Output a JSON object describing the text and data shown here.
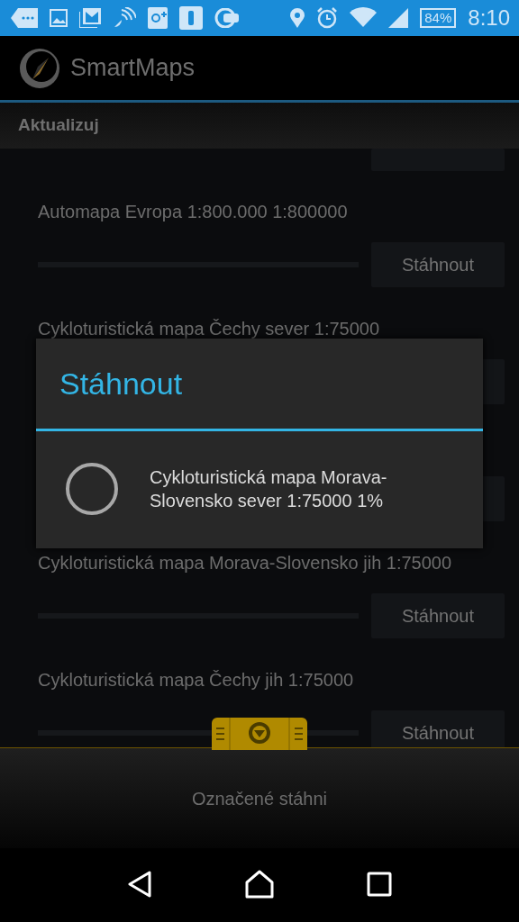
{
  "status_bar": {
    "battery": "84%",
    "time": "8:10"
  },
  "app_bar": {
    "title": "SmartMaps"
  },
  "section_header": {
    "label": "Aktualizuj"
  },
  "downloads": [
    {
      "kind": "clipped"
    },
    {
      "kind": "map",
      "title": "Automapa Evropa 1:800.000 1:800000",
      "level": 0,
      "button": "Stáhnout"
    },
    {
      "kind": "map",
      "title": "Cykloturistická mapa Čechy sever 1:75000"
    },
    {
      "kind": "covered"
    },
    {
      "kind": "map",
      "title": "Cykloturistická mapa Morava-Slovensko jih 1:75000",
      "level": 0,
      "button": "Stáhnout"
    },
    {
      "kind": "map",
      "title": "Cykloturistická mapa Čechy jih 1:75000",
      "level": 0,
      "button": "Stáhnout"
    }
  ],
  "dialog": {
    "title": "Stáhnout",
    "message": "Cykloturistická mapa Morava-Slovensko sever 1:75000 1%"
  },
  "bottom_bar": {
    "action": "Označené stáhni"
  }
}
